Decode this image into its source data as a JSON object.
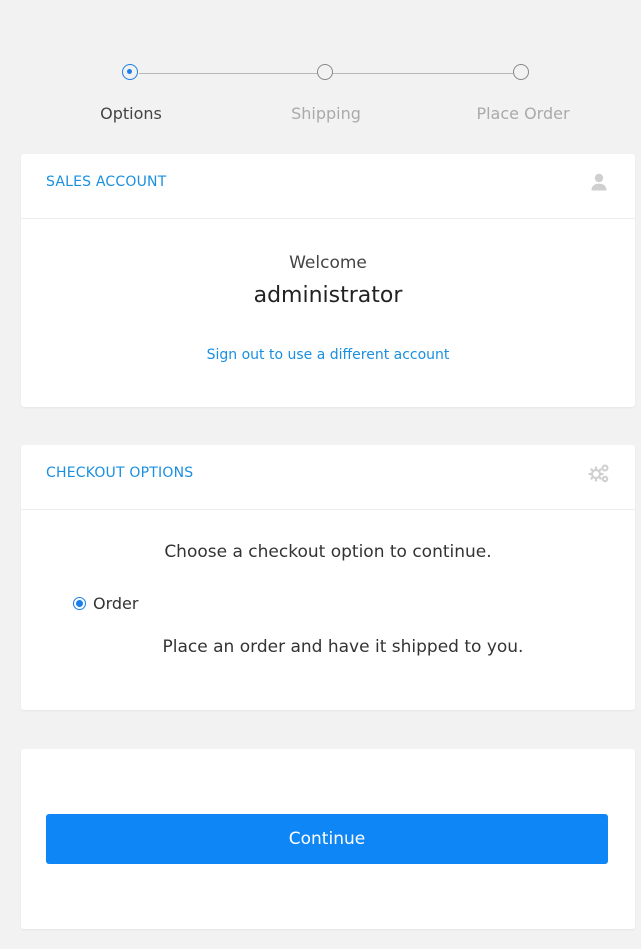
{
  "stepper": {
    "steps": [
      {
        "label": "Options",
        "state": "active"
      },
      {
        "label": "Shipping",
        "state": "inactive"
      },
      {
        "label": "Place Order",
        "state": "inactive"
      }
    ]
  },
  "sales_account": {
    "title": "SALES ACCOUNT",
    "icon": "user-icon",
    "welcome": "Welcome",
    "username": "administrator",
    "signout_link": "Sign out to use a different account"
  },
  "checkout_options": {
    "title": "CHECKOUT OPTIONS",
    "icon": "gears-icon",
    "prompt": "Choose a checkout option to continue.",
    "option_label": "Order",
    "option_selected": true,
    "option_description": "Place an order and have it shipped to you."
  },
  "actions": {
    "continue_label": "Continue"
  },
  "colors": {
    "accent": "#1a8fe0",
    "button": "#0f86f6",
    "background": "#f2f2f2"
  }
}
